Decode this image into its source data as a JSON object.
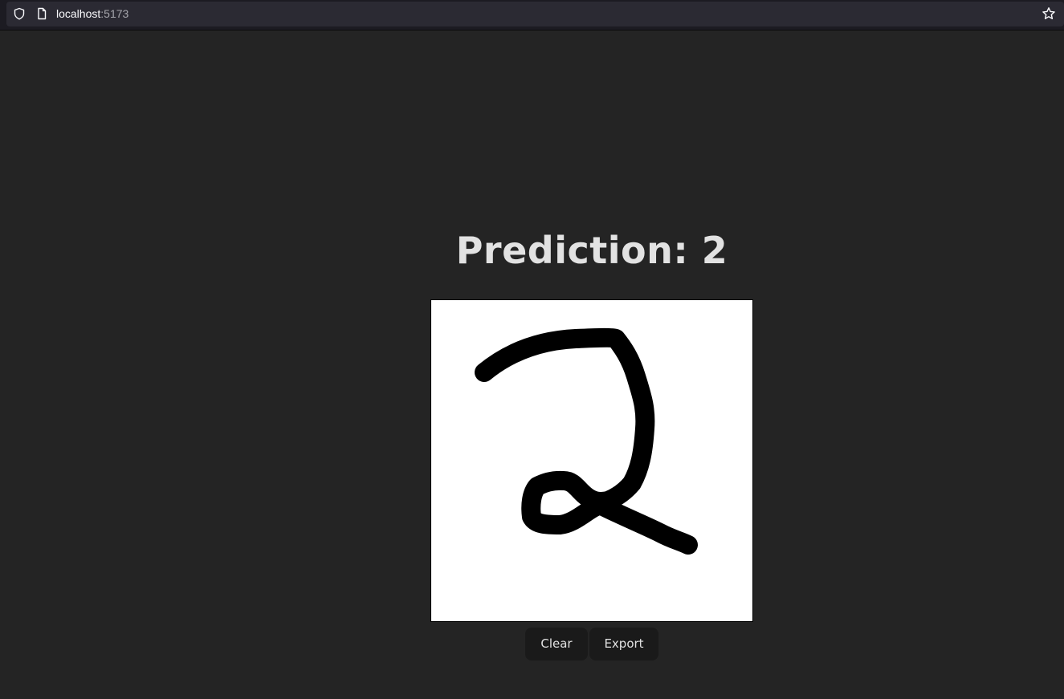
{
  "browser": {
    "url_host": "localhost",
    "url_port": ":5173",
    "icons": [
      "shield-icon",
      "page-icon",
      "bookmark-star-icon"
    ]
  },
  "main": {
    "prediction_label": "Prediction: 2",
    "drawing": "handwritten digit 2",
    "buttons": {
      "clear_label": "Clear",
      "export_label": "Export"
    }
  },
  "colors": {
    "page_background": "#242424",
    "canvas_background": "#ffffff",
    "stroke": "#000000",
    "button_background": "#1a1a1a",
    "text": "#dedede"
  }
}
